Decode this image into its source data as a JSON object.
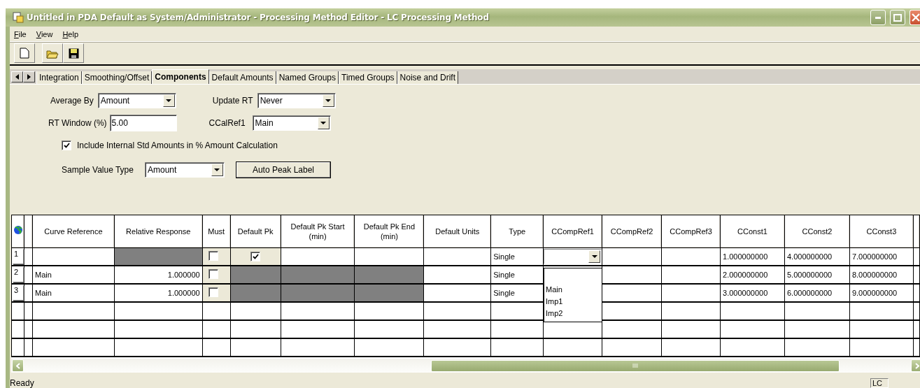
{
  "window": {
    "title": "Untitled in PDA Default as System/Administrator - Processing Method Editor - LC Processing Method"
  },
  "menu": [
    "File",
    "View",
    "Help"
  ],
  "tabs": [
    {
      "label": "Integration",
      "selected": false
    },
    {
      "label": "Smoothing/Offset",
      "selected": false
    },
    {
      "label": "Components",
      "selected": true
    },
    {
      "label": "Default Amounts",
      "selected": false
    },
    {
      "label": "Named Groups",
      "selected": false
    },
    {
      "label": "Timed Groups",
      "selected": false
    },
    {
      "label": "Noise and Drift",
      "selected": false
    }
  ],
  "form": {
    "average_by": {
      "label": "Average By",
      "value": "Amount"
    },
    "update_rt": {
      "label": "Update RT",
      "value": "Never"
    },
    "rt_window": {
      "label": "RT Window (%)",
      "value": "5.00"
    },
    "ccalref1": {
      "label": "CCalRef1",
      "value": "Main"
    },
    "include_istd": {
      "label": "Include Internal Std Amounts in % Amount Calculation",
      "checked": true
    },
    "sample_value_type": {
      "label": "Sample Value Type",
      "value": "Amount"
    },
    "auto_peak_button": "Auto Peak Label"
  },
  "table": {
    "columns": [
      "Curve Reference",
      "Relative Response",
      "Must",
      "Default Pk",
      "Default Pk Start (min)",
      "Default Pk End (min)",
      "Default Units",
      "Type",
      "CCompRef1",
      "CCompRef2",
      "CCompRef3",
      "CConst1",
      "CConst2",
      "CConst3"
    ],
    "rows": [
      {
        "number": "1",
        "cells": [
          {
            "kind": "empty"
          },
          {
            "kind": "shaded"
          },
          {
            "kind": "checkbox",
            "checked": false
          },
          {
            "kind": "checkbox",
            "checked": true
          },
          {
            "kind": "empty"
          },
          {
            "kind": "empty"
          },
          {
            "kind": "empty"
          },
          {
            "kind": "text",
            "text": "Single"
          },
          {
            "kind": "dropdown",
            "open": true
          },
          {
            "kind": "empty"
          },
          {
            "kind": "empty"
          },
          {
            "kind": "text",
            "text": "1.000000000"
          },
          {
            "kind": "text",
            "text": "4.000000000"
          },
          {
            "kind": "text",
            "text": "7.000000000"
          }
        ]
      },
      {
        "number": "2",
        "cells": [
          {
            "kind": "text",
            "text": "Main"
          },
          {
            "kind": "number",
            "text": "1.000000"
          },
          {
            "kind": "checkbox",
            "checked": false
          },
          {
            "kind": "shaded"
          },
          {
            "kind": "shaded"
          },
          {
            "kind": "shaded"
          },
          {
            "kind": "empty"
          },
          {
            "kind": "text",
            "text": "Single"
          },
          {
            "kind": "empty"
          },
          {
            "kind": "empty"
          },
          {
            "kind": "empty"
          },
          {
            "kind": "text",
            "text": "2.000000000"
          },
          {
            "kind": "text",
            "text": "5.000000000"
          },
          {
            "kind": "text",
            "text": "8.000000000"
          }
        ]
      },
      {
        "number": "3",
        "cells": [
          {
            "kind": "text",
            "text": "Main"
          },
          {
            "kind": "number",
            "text": "1.000000"
          },
          {
            "kind": "checkbox",
            "checked": false
          },
          {
            "kind": "shaded"
          },
          {
            "kind": "shaded"
          },
          {
            "kind": "shaded"
          },
          {
            "kind": "empty"
          },
          {
            "kind": "text",
            "text": "Single"
          },
          {
            "kind": "empty"
          },
          {
            "kind": "empty"
          },
          {
            "kind": "empty"
          },
          {
            "kind": "text",
            "text": "3.000000000"
          },
          {
            "kind": "text",
            "text": "6.000000000"
          },
          {
            "kind": "text",
            "text": "9.000000000"
          }
        ]
      },
      {
        "cells": []
      },
      {
        "cells": []
      },
      {
        "cells": []
      }
    ],
    "dropdown_options": [
      "Main",
      "Imp1",
      "Imp2"
    ]
  },
  "status_bar": {
    "message": "Ready",
    "mode": "LC"
  }
}
